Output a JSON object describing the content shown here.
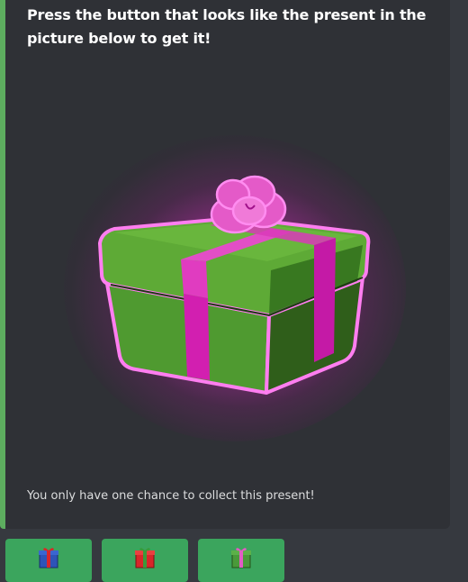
{
  "embed": {
    "title": "Press the button that looks like the present in the picture below to get it!",
    "footer": "You only have one chance to collect this present!",
    "accent_color": "#5dad5f",
    "image": {
      "icon": "green-present-pink-ribbon-icon",
      "box_color": "#3f8a2a",
      "ribbon_color": "#d21fb0",
      "glow_color": "#ff3cdc"
    }
  },
  "buttons": [
    {
      "icon": "blue-present-red-ribbon-icon",
      "box_color": "#2e54b8",
      "ribbon_color": "#d8262a"
    },
    {
      "icon": "red-present-green-ribbon-icon",
      "box_color": "#d8262a",
      "ribbon_color": "#3a9a3a"
    },
    {
      "icon": "green-present-pink-ribbon-icon",
      "box_color": "#4a9a3a",
      "ribbon_color": "#e25cc4"
    }
  ],
  "button_color": "#3ba55d"
}
